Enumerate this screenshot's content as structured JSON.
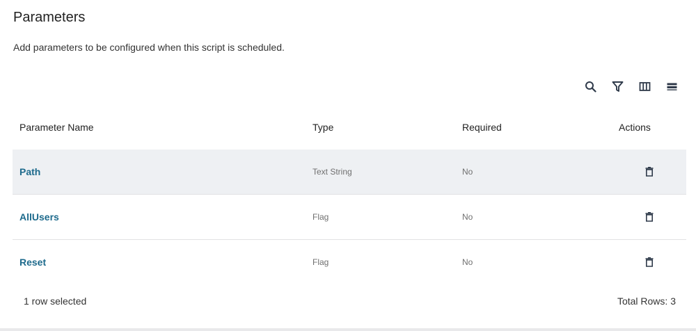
{
  "header": {
    "title": "Parameters",
    "subtitle": "Add parameters to be configured when this script is scheduled."
  },
  "toolbar": {
    "icons": [
      "search-icon",
      "filter-icon",
      "columns-icon",
      "density-icon"
    ]
  },
  "table": {
    "columns": [
      "Parameter Name",
      "Type",
      "Required",
      "Actions"
    ],
    "rows": [
      {
        "name": "Path",
        "type": "Text String",
        "required": "No",
        "selected": true
      },
      {
        "name": "AllUsers",
        "type": "Flag",
        "required": "No",
        "selected": false
      },
      {
        "name": "Reset",
        "type": "Flag",
        "required": "No",
        "selected": false
      }
    ]
  },
  "footer": {
    "selection": "1 row selected",
    "total": "Total Rows: 3"
  },
  "colors": {
    "link": "#1d6a8c",
    "selected_row": "#eef0f3",
    "icon": "#2f3a4a"
  }
}
